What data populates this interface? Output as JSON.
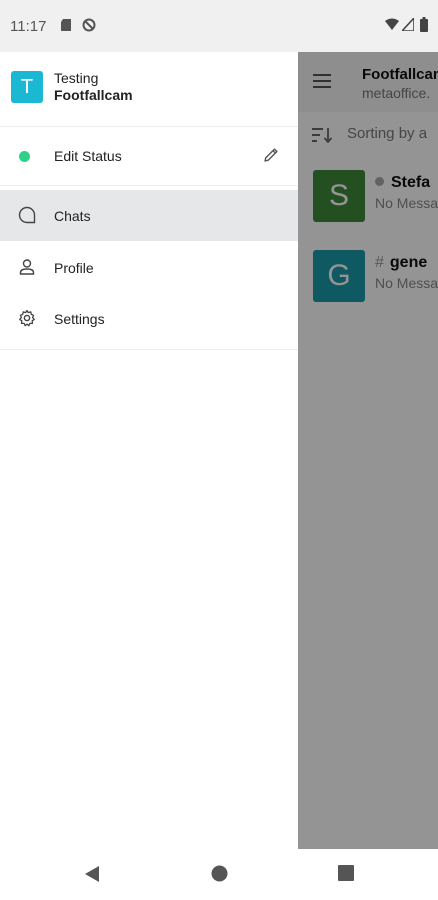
{
  "status_bar": {
    "time": "11:17"
  },
  "chat_pane": {
    "workspace_name": "Footfallcam",
    "workspace_host": "metaoffice.",
    "sort_label": "Sorting by a",
    "rooms": [
      {
        "initial": "S",
        "name": "Stefa",
        "last_message": "No Messa",
        "color": "#3f8a3a"
      },
      {
        "initial": "G",
        "name": "gene",
        "last_message": "No Messa",
        "color": "#1a9aaa"
      }
    ]
  },
  "drawer": {
    "user": {
      "initial": "T",
      "name": "Testing",
      "server": "Footfallcam",
      "avatar_color": "#1ab8d2"
    },
    "status": {
      "label": "Edit Status",
      "color": "#2ed187"
    },
    "nav": [
      {
        "label": "Chats",
        "icon": "chat-bubble-icon",
        "active": true
      },
      {
        "label": "Profile",
        "icon": "person-icon",
        "active": false
      },
      {
        "label": "Settings",
        "icon": "gear-icon",
        "active": false
      }
    ]
  }
}
